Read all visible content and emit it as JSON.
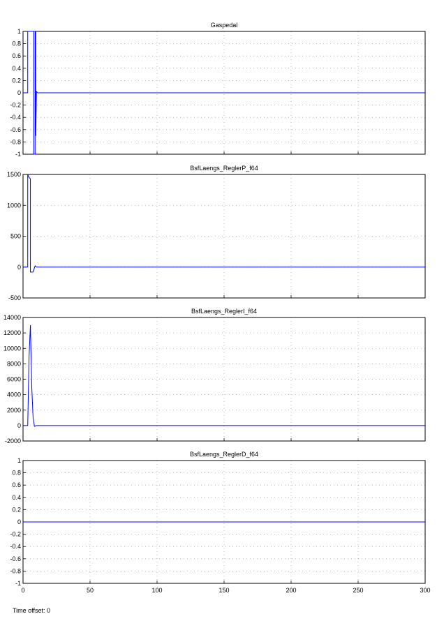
{
  "footer": {
    "time_offset": "Time offset: 0"
  },
  "colors": {
    "line": "#0000ff",
    "grid": "#aaaaaa",
    "axes": "#000000"
  },
  "chart_data": [
    {
      "type": "line",
      "title": "Gaspedal",
      "xlim": [
        0,
        300
      ],
      "ylim": [
        -1,
        1
      ],
      "yticks": [
        -1,
        -0.8,
        -0.6,
        -0.4,
        -0.2,
        0,
        0.2,
        0.4,
        0.6,
        0.8,
        1
      ],
      "grid": true,
      "series": [
        {
          "name": "Gaspedal",
          "x": [
            0,
            3.5,
            3.5,
            8,
            8,
            9,
            9,
            9.5,
            9.5,
            10,
            11,
            300
          ],
          "y": [
            0,
            0,
            1,
            1,
            -1,
            -1,
            1,
            1,
            -0.7,
            0.02,
            0,
            0
          ]
        }
      ]
    },
    {
      "type": "line",
      "title": "BsfLaengs_ReglerP_f64",
      "xlim": [
        0,
        300
      ],
      "ylim": [
        -500,
        1500
      ],
      "yticks": [
        -500,
        0,
        500,
        1000,
        1500
      ],
      "grid": true,
      "series": [
        {
          "name": "BsfLaengs_ReglerP_f64",
          "x": [
            0,
            3.5,
            3.5,
            4.5,
            5.5,
            5.5,
            7.5,
            9,
            10,
            300
          ],
          "y": [
            0,
            0,
            1500,
            1450,
            1430,
            -80,
            -80,
            20,
            0,
            0
          ]
        }
      ]
    },
    {
      "type": "line",
      "title": "BsfLaengs_ReglerI_f64",
      "xlim": [
        0,
        300
      ],
      "ylim": [
        -2000,
        14000
      ],
      "yticks": [
        -2000,
        0,
        2000,
        4000,
        6000,
        8000,
        10000,
        12000,
        14000
      ],
      "grid": true,
      "series": [
        {
          "name": "BsfLaengs_ReglerI_f64",
          "x": [
            0,
            3.5,
            4.5,
            5.5,
            6.5,
            7.5,
            8.5,
            10,
            300
          ],
          "y": [
            0,
            0,
            9000,
            13000,
            5000,
            1000,
            -100,
            0,
            0
          ]
        }
      ]
    },
    {
      "type": "line",
      "title": "BsfLaengs_ReglerD_f64",
      "xlim": [
        0,
        300
      ],
      "ylim": [
        -1,
        1
      ],
      "yticks": [
        -1,
        -0.8,
        -0.6,
        -0.4,
        -0.2,
        0,
        0.2,
        0.4,
        0.6,
        0.8,
        1
      ],
      "xticks": [
        0,
        50,
        100,
        150,
        200,
        250,
        300
      ],
      "grid": true,
      "series": [
        {
          "name": "BsfLaengs_ReglerD_f64",
          "x": [
            0,
            300
          ],
          "y": [
            0,
            0
          ]
        }
      ]
    }
  ]
}
